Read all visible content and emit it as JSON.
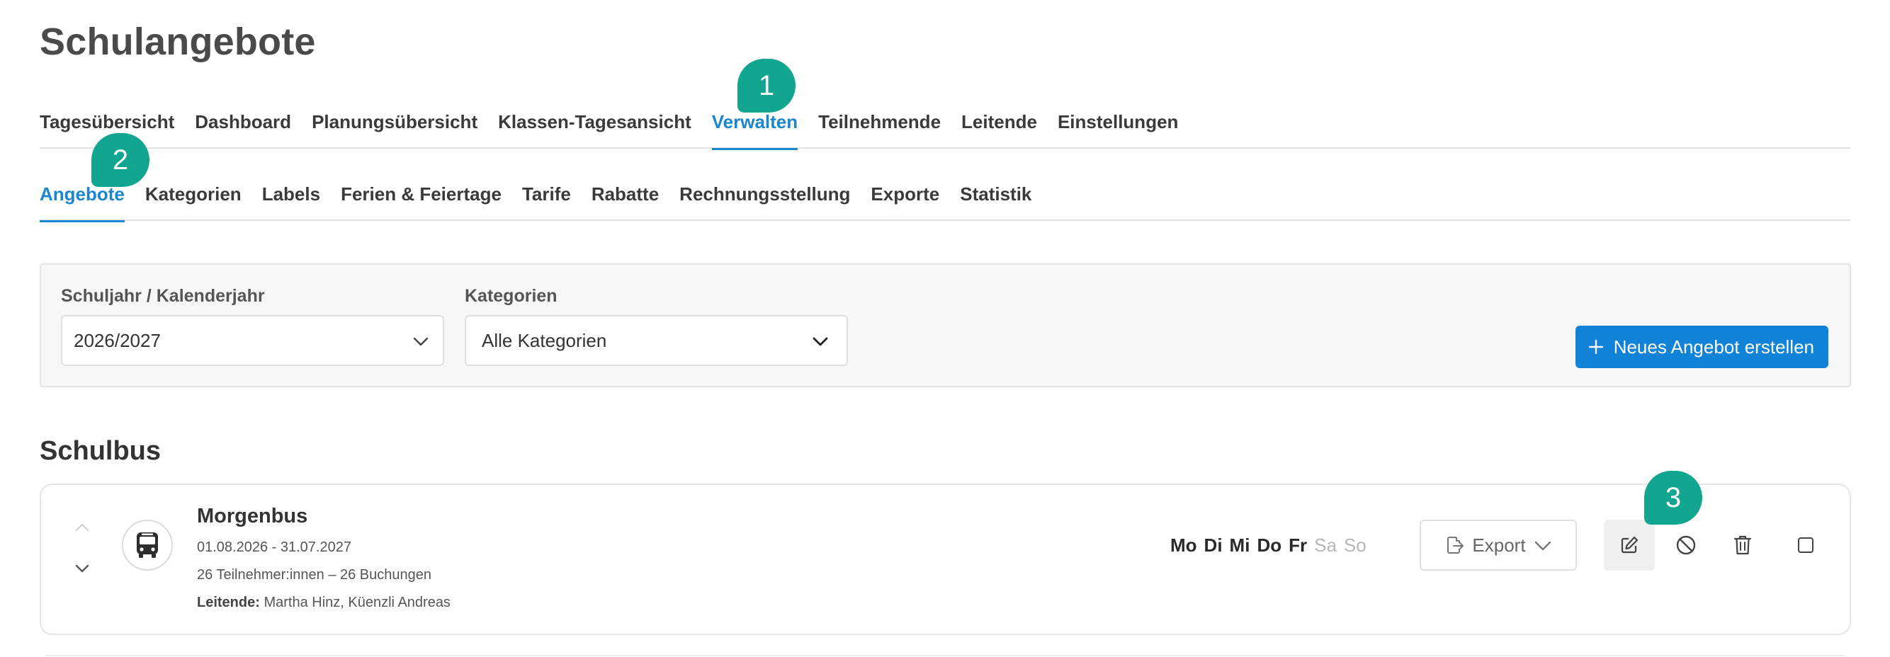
{
  "page": {
    "title": "Schulangebote"
  },
  "main_tabs": [
    {
      "label": "Tagesübersicht"
    },
    {
      "label": "Dashboard"
    },
    {
      "label": "Planungsübersicht"
    },
    {
      "label": "Klassen-Tagesansicht"
    },
    {
      "label": "Verwalten",
      "active": true
    },
    {
      "label": "Teilnehmende"
    },
    {
      "label": "Leitende"
    },
    {
      "label": "Einstellungen"
    }
  ],
  "sub_tabs": [
    {
      "label": "Angebote",
      "active": true
    },
    {
      "label": "Kategorien"
    },
    {
      "label": "Labels"
    },
    {
      "label": "Ferien & Feiertage"
    },
    {
      "label": "Tarife"
    },
    {
      "label": "Rabatte"
    },
    {
      "label": "Rechnungsstellung"
    },
    {
      "label": "Exporte"
    },
    {
      "label": "Statistik"
    }
  ],
  "markers": [
    "1",
    "2",
    "3"
  ],
  "filters": {
    "year_label": "Schuljahr / Kalenderjahr",
    "year_value": "2026/2027",
    "category_label": "Kategorien",
    "category_value": "Alle Kategorien",
    "new_button_label": "Neues Angebot erstellen"
  },
  "section": {
    "title": "Schulbus"
  },
  "offer": {
    "title": "Morgenbus",
    "date_range": "01.08.2026 - 31.07.2027",
    "participants": "26 Teilnehmer:innen – 26 Buchungen",
    "leaders_label": "Leitende:",
    "leaders_value": "Martha Hinz, Küenzli Andreas",
    "days": [
      {
        "label": "Mo",
        "active": true
      },
      {
        "label": "Di",
        "active": true
      },
      {
        "label": "Mi",
        "active": true
      },
      {
        "label": "Do",
        "active": true
      },
      {
        "label": "Fr",
        "active": true
      },
      {
        "label": "Sa",
        "active": false
      },
      {
        "label": "So",
        "active": false
      }
    ],
    "export_label": "Export"
  },
  "colors": {
    "accent": "#1a86d0",
    "marker": "#12a58f",
    "primary_button": "#1082d8"
  }
}
